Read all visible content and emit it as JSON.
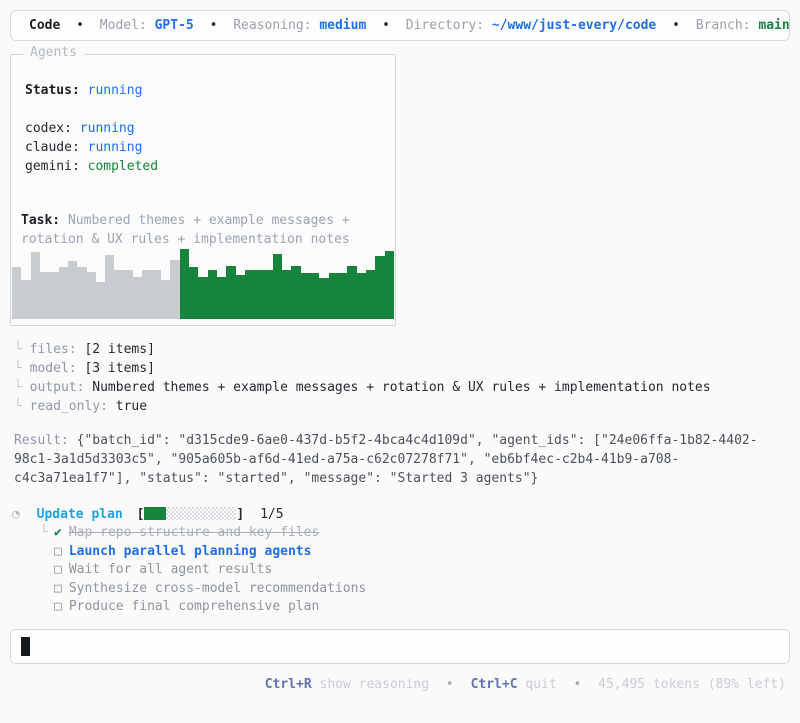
{
  "header": {
    "app": "Code",
    "sep": "•",
    "model_label": "Model:",
    "model": "GPT-5",
    "reasoning_label": "Reasoning:",
    "reasoning": "medium",
    "directory_label": "Directory:",
    "directory": "~/www/just-every/code",
    "branch_label": "Branch:",
    "branch": "main"
  },
  "agents_panel": {
    "title": "Agents",
    "status_label": "Status:",
    "status": "running",
    "agents": [
      {
        "name": "codex:",
        "state": "running",
        "state_color": "blue"
      },
      {
        "name": "claude:",
        "state": "running",
        "state_color": "blue"
      },
      {
        "name": "gemini:",
        "state": "completed",
        "state_color": "green"
      }
    ],
    "task_label": "Task:",
    "task": "Numbered themes + example messages + rotation & UX rules + implementation notes",
    "sparkline": {
      "gray_color": "#c9cccf",
      "green_color": "#17843c",
      "gray_values": [
        70,
        53,
        90,
        64,
        64,
        70,
        78,
        70,
        64,
        50,
        87,
        66,
        66,
        57,
        66,
        66,
        53,
        80
      ],
      "green_values": [
        95,
        70,
        57,
        66,
        57,
        72,
        60,
        66,
        66,
        66,
        88,
        66,
        72,
        62,
        62,
        55,
        62,
        62,
        72,
        62,
        66,
        85,
        92
      ]
    }
  },
  "params": [
    {
      "prefix": "└",
      "key": "files:",
      "value": "[2 items]"
    },
    {
      "prefix": "└",
      "key": "model:",
      "value": "[3 items]"
    },
    {
      "prefix": "└",
      "key": "output:",
      "value": "Numbered themes + example messages + rotation & UX rules + implementation notes"
    },
    {
      "prefix": "└",
      "key": "read_only:",
      "value": "true"
    }
  ],
  "result": {
    "label": "Result:",
    "text": "{\"batch_id\": \"d315cde9-6ae0-437d-b5f2-4bca4c4d109d\", \"agent_ids\": [\"24e06ffa-1b82-4402-98c1-3a1d5d3303c5\", \"905a605b-af6d-41ed-a75a-c62c07278f71\", \"eb6bf4ec-c2b4-41b9-a708-c4c3a71ea1f7\"], \"status\": \"started\", \"message\": \"Started 3 agents\"}"
  },
  "plan": {
    "status_icon": "◔",
    "title": "Update plan",
    "bracket_open": "[",
    "bracket_close": "]",
    "progress": "1/5",
    "items": [
      {
        "state": "done",
        "prefix": "└",
        "glyph": "✔",
        "label": "Map repo structure and key files"
      },
      {
        "state": "active",
        "prefix": "",
        "glyph": "□",
        "label": "Launch parallel planning agents"
      },
      {
        "state": "pending",
        "prefix": "",
        "glyph": "□",
        "label": "Wait for all agent results"
      },
      {
        "state": "pending",
        "prefix": "",
        "glyph": "□",
        "label": "Synthesize cross-model recommendations"
      },
      {
        "state": "pending",
        "prefix": "",
        "glyph": "□",
        "label": "Produce final comprehensive plan"
      }
    ]
  },
  "composer": {
    "value": ""
  },
  "footer": {
    "sep": "•",
    "shortcut1_key": "Ctrl+R",
    "shortcut1_label": "show reasoning",
    "shortcut2_key": "Ctrl+C",
    "shortcut2_label": "quit",
    "tokens": "45,495 tokens (89% left)"
  },
  "colors": {
    "accent_blue": "#1f6feb",
    "accent_cyan": "#1ba2e0",
    "accent_green": "#17843c",
    "bar_gray": "#c9cccf"
  }
}
